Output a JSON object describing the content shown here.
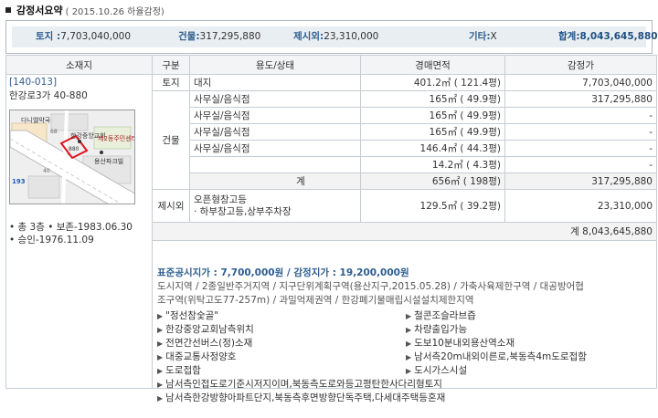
{
  "header": {
    "title": "감정서요약",
    "subtitle": "( 2015.10.26  하율감정)"
  },
  "summary": {
    "land_label": "토지 :",
    "land_value": "7,703,040,000",
    "building_label": "건물:",
    "building_value": "317,295,880",
    "excluded_label": "제시외:",
    "excluded_value": "23,310,000",
    "other_label": "기타:",
    "other_value": "X",
    "total_label": "합계:",
    "total_value": "8,043,645,880"
  },
  "table": {
    "headers": [
      "소재지",
      "구분",
      "용도/상태",
      "경매면적",
      "감정가"
    ],
    "location": {
      "code": "[140-013]",
      "address": "한강로3가 40-880",
      "info": [
        "• 총 3층  • 보존-1983.06.30",
        "• 승인-1976.11.09"
      ],
      "map_labels": {
        "pharmacy": "다니엘약국",
        "church": "한강중앙교회",
        "hall": "제2동주민센터",
        "park": "용산파크빌",
        "lot": "880",
        "num1": "193",
        "num2": "68",
        "num3": "40"
      }
    },
    "land_row": {
      "category": "토지",
      "use": "대지",
      "area": "401.2㎡  ( 121.4평)",
      "price": "7,703,040,000"
    },
    "building_category": "건물",
    "building_rows": [
      {
        "use": "사무실/음식점",
        "area": "165㎡  ( 49.9평)",
        "price": "317,295,880"
      },
      {
        "use": "사무실/음식점",
        "area": "165㎡  ( 49.9평)",
        "price": "-"
      },
      {
        "use": "사무실/음식점",
        "area": "165㎡  ( 49.9평)",
        "price": "-"
      },
      {
        "use": "사무실/음식점",
        "area": "146.4㎡  ( 44.3평)",
        "price": "-"
      },
      {
        "use": "",
        "area": "14.2㎡  ( 4.3평)",
        "price": "-"
      }
    ],
    "building_subtotal": {
      "label": "계",
      "area": "656㎡  ( 198평)",
      "price": "317,295,880"
    },
    "excluded_row": {
      "category": "제시외",
      "use1": "오픈형창고등",
      "use2": "· 하부창고등,상부주차장",
      "area": "129.5㎡  ( 39.2평)",
      "price": "23,310,000"
    },
    "grand_total": "계  8,043,645,880"
  },
  "details": {
    "price_line": "표준공시지가 : 7,700,000원 / 감정지가 : 19,200,000원",
    "zone_line1": "도시지역 / 2종일반주거지역 / 지구단위계획구역(용산지구,2015.05.28) / 가축사육제한구역 / 대공방어협",
    "zone_line2": "조구역(위탁고도77-257m) / 과밀억제권역 / 한강폐기물매립시설설치제한지역",
    "features_left": [
      "\"정선참숯골\"",
      "한강중앙교회남측위치",
      "전면간선버스(정)소재",
      "대중교통사정양호",
      "도로접함"
    ],
    "features_right": [
      "철콘조슬라브즙",
      "차량출입가능",
      "도보10분내외용산역소재",
      "남서측20m내외이른로,북동측4m도로접함",
      "도시가스시설"
    ],
    "features_full": [
      "남서측인접도로기준시저지이며,북동측도로와등고평탄한사다리형토지",
      "남서측한강방향아파트단지,북동측후면방향단독주택,다세대주택등혼재"
    ]
  }
}
